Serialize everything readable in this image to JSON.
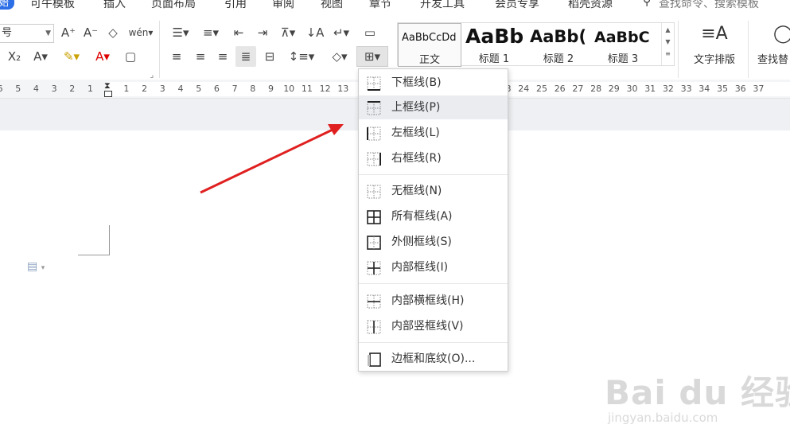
{
  "menubar": {
    "first_tab": "始",
    "tabs": [
      "可牛模板",
      "插入",
      "页面布局",
      "引用",
      "审阅",
      "视图",
      "章节",
      "开发工具",
      "会员专享",
      "稻壳资源"
    ],
    "search_placeholder": "查找命令、搜索模板"
  },
  "ribbon": {
    "font_size_value": "号",
    "pinyin_label": "wén",
    "styles": [
      {
        "preview": "AaBbCcDd",
        "name": "正文"
      },
      {
        "preview": "AaBb",
        "name": "标题 1"
      },
      {
        "preview": "AaBb(",
        "name": "标题 2"
      },
      {
        "preview": "AaBbC",
        "name": "标题 3"
      }
    ],
    "text_layout_label": "文字排版",
    "find_replace_label": "查找替"
  },
  "ruler": {
    "ticks": [
      "6",
      "5",
      "4",
      "3",
      "2",
      "1",
      "",
      "1",
      "2",
      "3",
      "4",
      "5",
      "6",
      "7",
      "8",
      "9",
      "10",
      "11",
      "12",
      "13",
      "",
      "",
      "",
      "",
      "",
      "",
      "",
      "22",
      "23",
      "24",
      "25",
      "26",
      "27",
      "28",
      "29",
      "30",
      "31",
      "32",
      "33",
      "34",
      "35",
      "36",
      "37"
    ]
  },
  "border_menu": {
    "items": [
      {
        "label": "下框线(B)",
        "icon": "bottom-border-icon"
      },
      {
        "label": "上框线(P)",
        "icon": "top-border-icon",
        "highlighted": true
      },
      {
        "label": "左框线(L)",
        "icon": "left-border-icon"
      },
      {
        "label": "右框线(R)",
        "icon": "right-border-icon"
      },
      {
        "label": "无框线(N)",
        "icon": "no-border-icon"
      },
      {
        "label": "所有框线(A)",
        "icon": "all-borders-icon"
      },
      {
        "label": "外侧框线(S)",
        "icon": "outside-borders-icon"
      },
      {
        "label": "内部框线(I)",
        "icon": "inside-borders-icon"
      },
      {
        "label": "内部横框线(H)",
        "icon": "inside-horizontal-border-icon"
      },
      {
        "label": "内部竖框线(V)",
        "icon": "inside-vertical-border-icon"
      },
      {
        "label": "边框和底纹(O)...",
        "icon": "borders-shading-icon"
      }
    ]
  },
  "watermark": {
    "logo": "Bai du 经验",
    "sub": "jingyan.baidu.com"
  },
  "colors": {
    "accent": "#2d6fe6",
    "arrow": "#e02020",
    "highlight": "#eaecf0"
  }
}
